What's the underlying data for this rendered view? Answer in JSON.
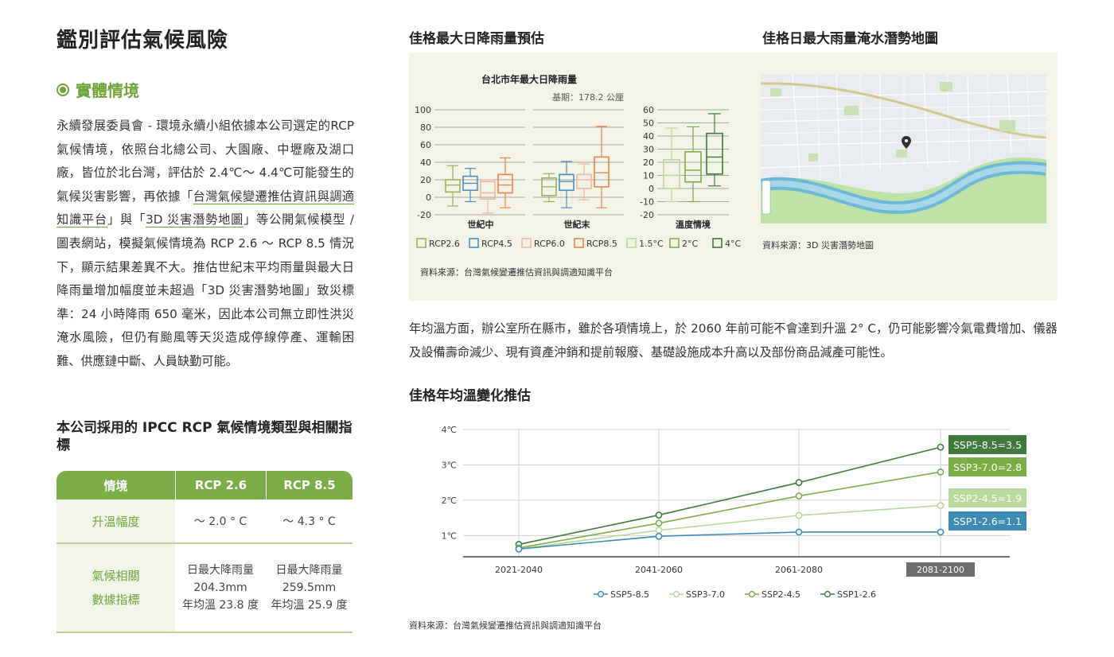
{
  "page": {
    "title": "鑑別評估氣候風險",
    "section_title": "實體情境",
    "body": {
      "p1": "永續發展委員會 - 環境永續小組依據本公司選定的RCP 氣候情境，依照台北總公司、大園廠、中壢廠及湖口廠，皆位於北台灣，評估於 2.4℃～ 4.4℃可能發生的氣候災害影響，再依據「",
      "link1": "台灣氣候變遷推估資訊與調適知識平台",
      "p2": "」與「",
      "link2": "3D 災害潛勢地圖",
      "p3": "」等公開氣候模型 / 圖表網站，模擬氣候情境為 RCP 2.6 ～ RCP 8.5 情況下，顯示結果差異不大。推估世紀末平均雨量與最大日降雨量增加幅度並未超過「3D 災害潛勢地圖」致災標準：24 小時降雨 650 毫米，因此本公司無立即性洪災淹水風險，但仍有颱風等天災造成停線停產、運輸困難、供應鏈中斷、人員缺勤可能。"
    },
    "table_title": "本公司採用的 IPCC RCP 氣候情境類型與相關指標",
    "table": {
      "headers": [
        "情境",
        "RCP 2.6",
        "RCP 8.5"
      ],
      "row1": {
        "label": "升溫幅度",
        "rcp26": "～ 2.0 ° C",
        "rcp85": "～ 4.3 ° C"
      },
      "row2": {
        "label_a": "氣候相關",
        "label_b": "數據指標",
        "rcp26_a": "日最大降雨量",
        "rcp26_b": "204.3mm",
        "rcp26_c": "年均溫 23.8 度",
        "rcp85_a": "日最大降雨量",
        "rcp85_b": "259.5mm",
        "rcp85_c": "年均溫 25.9 度"
      }
    },
    "rain_title": "佳格最大日降雨量預估",
    "map_title": "佳格日最大雨量淹水潛勢地圖",
    "map_source": "資料來源：3D 災害潛勢地圖",
    "panel_source": "資料來源：台灣氣候變遷推估資訊與調適知識平台",
    "temp_paragraph": "年均溫方面，辦公室所在縣市，雖於各項情境上，於 2060 年前可能不會達到升溫 2° C，仍可能影響冷氣電費增加、儀器及設備壽命減少、現有資產沖銷和提前報廢、基礎設施成本升高以及部份商品減產可能性。",
    "temp_title": "佳格年均溫變化推估",
    "bottom_source": "資料來源：台灣氣候變遷推估資訊與調適知識平台"
  },
  "chart_data": [
    {
      "type": "box",
      "title": "台北市年最大日降雨量",
      "subtitle": "基期：178.2 公厘",
      "ylim": [
        -20,
        100
      ],
      "yticks": [
        "100",
        "80",
        "60",
        "40",
        "20",
        "0",
        "-20"
      ],
      "groups": [
        "世紀中",
        "世紀末"
      ],
      "series": [
        {
          "name": "RCP2.6",
          "color": "#9ab35a",
          "boxes": [
            {
              "min": -10,
              "q1": 6,
              "med": 14,
              "q3": 20,
              "max": 36
            },
            {
              "min": -5,
              "q1": 2,
              "med": 12,
              "q3": 22,
              "max": 27
            }
          ]
        },
        {
          "name": "RCP4.5",
          "color": "#4a8fc4",
          "boxes": [
            {
              "min": -5,
              "q1": 8,
              "med": 16,
              "q3": 24,
              "max": 33
            },
            {
              "min": -12,
              "q1": 8,
              "med": 18,
              "q3": 26,
              "max": 41
            }
          ]
        },
        {
          "name": "RCP6.0",
          "color": "#f0b7a0",
          "boxes": [
            {
              "min": -18,
              "q1": -2,
              "med": 5,
              "q3": 18,
              "max": 20
            },
            {
              "min": -3,
              "q1": 10,
              "med": 20,
              "q3": 26,
              "max": 38
            }
          ]
        },
        {
          "name": "RCP8.5",
          "color": "#e8834a",
          "boxes": [
            {
              "min": -12,
              "q1": 5,
              "med": 14,
              "q3": 26,
              "max": 45
            },
            {
              "min": -12,
              "q1": 12,
              "med": 28,
              "q3": 46,
              "max": 81
            }
          ]
        }
      ]
    },
    {
      "type": "box",
      "title": "",
      "ylim": [
        -20,
        60
      ],
      "yticks": [
        "60",
        "50",
        "40",
        "30",
        "20",
        "10",
        "0",
        "-10",
        "-20"
      ],
      "groups": [
        "溫度情境"
      ],
      "series": [
        {
          "name": "1.5°C",
          "color": "#b9d99a",
          "boxes": [
            {
              "min": -10,
              "q1": 0,
              "med": 10,
              "q3": 22,
              "max": 46
            }
          ]
        },
        {
          "name": "2°C",
          "color": "#7aad45",
          "boxes": [
            {
              "min": -10,
              "q1": 5,
              "med": 14,
              "q3": 28,
              "max": 47
            }
          ]
        },
        {
          "name": "4°C",
          "color": "#3e7b3a",
          "boxes": [
            {
              "min": 2,
              "q1": 11,
              "med": 24,
              "q3": 42,
              "max": 57
            }
          ]
        }
      ]
    },
    {
      "type": "line",
      "x": [
        "2021-2040",
        "2041-2060",
        "2061-2080",
        "2081-2100"
      ],
      "yticks": [
        "4℃",
        "3℃",
        "2℃",
        "1℃"
      ],
      "ylim": [
        0.4,
        4
      ],
      "highlight_x": "2081-2100",
      "series": [
        {
          "name": "SSP5-8.5",
          "color": "#3e7b3a",
          "values": [
            0.75,
            1.58,
            2.5,
            3.5
          ],
          "label": "SSP5-8.5=3.5"
        },
        {
          "name": "SSP3-7.0",
          "color": "#7aad45",
          "values": [
            0.65,
            1.35,
            2.12,
            2.8
          ],
          "label": "SSP3-7.0=2.8"
        },
        {
          "name": "SSP2-4.5",
          "color": "#b9d99a",
          "values": [
            0.62,
            1.15,
            1.57,
            1.85
          ],
          "label": "SSP2-4.5=1.9"
        },
        {
          "name": "SSP1-2.6",
          "color": "#3c8bb5",
          "values": [
            0.62,
            0.98,
            1.1,
            1.1
          ],
          "label": "SSP1-2.6=1.1"
        }
      ],
      "legend": [
        {
          "name": "SSP5-8.5",
          "color": "#3c8bb5"
        },
        {
          "name": "SSP3-7.0",
          "color": "#b9d99a"
        },
        {
          "name": "SSP2-4.5",
          "color": "#7aad45"
        },
        {
          "name": "SSP1-2.6",
          "color": "#3e7b3a"
        }
      ]
    }
  ]
}
